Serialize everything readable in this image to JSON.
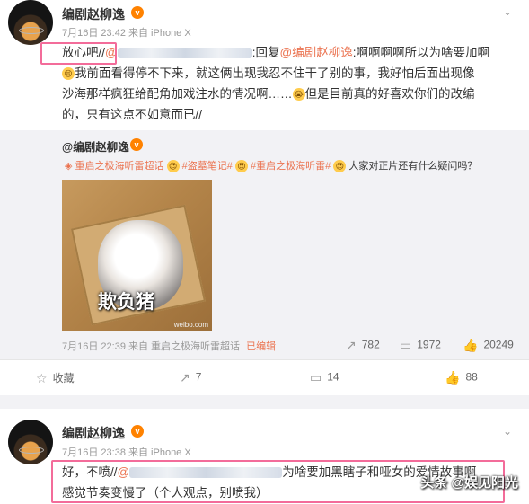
{
  "post1": {
    "username": "编剧赵柳逸",
    "meta": "7月16日 23:42 来自 iPhone X",
    "text_start": "放心吧//",
    "at_prefix": "@",
    "text_reply": ":回复",
    "mention": "@编剧赵柳逸",
    "line1_tail": ":啊啊啊啊所以为啥要加啊",
    "line2": "我前面看得停不下来，就这俩出现我忍不住干了别的事，我好怕后面出现像",
    "line3": "沙海那样疯狂给配角加戏注水的情况啊……",
    "line3_tail": "但是目前真的好喜欢你们的改编",
    "line4": "的，只有这点不如意而已//",
    "repost": {
      "author": "@编剧赵柳逸",
      "topic1": "重启之极海听雷超话",
      "topic2": "#盗墓笔记#",
      "topic3": "#重启之极海听雷#",
      "question": "大家对正片还有什么疑问吗？",
      "image_caption": "欺负猪",
      "image_watermark": "weibo.com",
      "meta": "7月16日 22:39 来自 重启之极海听雷超话",
      "edited": "已编辑",
      "reposts": "782",
      "comments": "1972",
      "likes": "20249"
    },
    "actions": {
      "favorite": "收藏",
      "repost": "7",
      "comment": "14",
      "like": "88"
    }
  },
  "post2": {
    "username": "编剧赵柳逸",
    "meta": "7月16日 23:38 来自 iPhone X",
    "text_start": "好，不喷//",
    "at_prefix": "@",
    "line1_tail": "为啥要加黑瞎子和哑女的爱情故事啊",
    "line2": "感觉节奏变慢了（个人观点，别喷我）"
  },
  "watermark": "头条 @娱见阳光",
  "icons": {
    "vip": "v-badge-icon",
    "chevron": "chevron-down-icon",
    "repost": "repost-icon",
    "comment": "comment-icon",
    "like": "like-icon",
    "favorite": "star-icon"
  }
}
